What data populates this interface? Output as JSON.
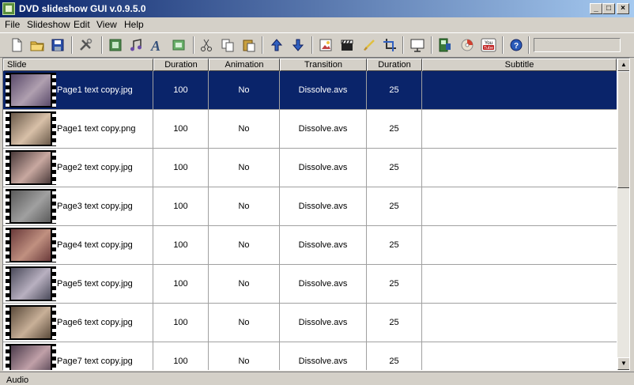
{
  "window": {
    "title": "DVD slideshow GUI v.0.9.5.0"
  },
  "window_controls": [
    "_",
    "□",
    "×"
  ],
  "menu": [
    "File",
    "Slideshow",
    "Edit",
    "View",
    "Help"
  ],
  "toolbar_icons": [
    "new-file-icon",
    "open-folder-icon",
    "save-icon",
    "tools-icon",
    "add-slide-icon",
    "music-icon",
    "text-icon",
    "picture-icon",
    "cut-icon",
    "copy-icon",
    "paste-icon",
    "move-up-icon",
    "move-down-icon",
    "edit-image-icon",
    "clapperboard-icon",
    "brush-icon",
    "crop-icon",
    "preview-icon",
    "encode-dvd-icon",
    "burn-disc-icon",
    "youtube-icon",
    "help-icon"
  ],
  "youtube_label": "You Tube",
  "columns": [
    "Slide",
    "Duration",
    "Animation",
    "Transition",
    "Duration",
    "Subtitle"
  ],
  "rows": [
    {
      "name": "Page1 text copy.jpg",
      "duration": "100",
      "animation": "No",
      "transition": "Dissolve.avs",
      "tduration": "25",
      "subtitle": "",
      "selected": true
    },
    {
      "name": "Page1 text copy.png",
      "duration": "100",
      "animation": "No",
      "transition": "Dissolve.avs",
      "tduration": "25",
      "subtitle": ""
    },
    {
      "name": "Page2 text copy.jpg",
      "duration": "100",
      "animation": "No",
      "transition": "Dissolve.avs",
      "tduration": "25",
      "subtitle": ""
    },
    {
      "name": "Page3 text copy.jpg",
      "duration": "100",
      "animation": "No",
      "transition": "Dissolve.avs",
      "tduration": "25",
      "subtitle": ""
    },
    {
      "name": "Page4 text copy.jpg",
      "duration": "100",
      "animation": "No",
      "transition": "Dissolve.avs",
      "tduration": "25",
      "subtitle": ""
    },
    {
      "name": "Page5 text copy.jpg",
      "duration": "100",
      "animation": "No",
      "transition": "Dissolve.avs",
      "tduration": "25",
      "subtitle": ""
    },
    {
      "name": "Page6 text copy.jpg",
      "duration": "100",
      "animation": "No",
      "transition": "Dissolve.avs",
      "tduration": "25",
      "subtitle": ""
    },
    {
      "name": "Page7 text copy.jpg",
      "duration": "100",
      "animation": "No",
      "transition": "Dissolve.avs",
      "tduration": "25",
      "subtitle": ""
    }
  ],
  "bottom_label": "Audio",
  "colors": {
    "selection": "#0a246a",
    "titlebar": "#0a246a",
    "chrome": "#d4d0c8"
  }
}
